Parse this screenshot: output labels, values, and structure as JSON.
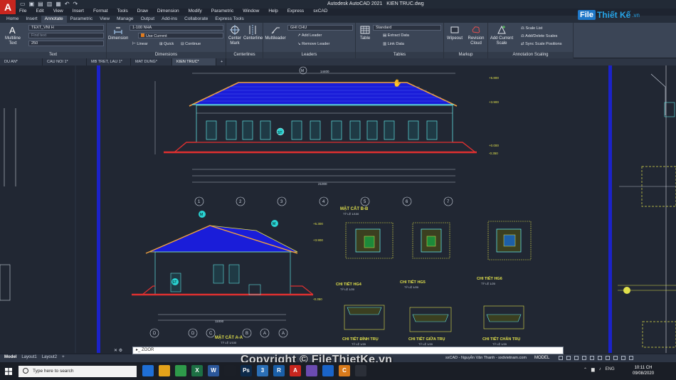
{
  "title": {
    "app": "Autodesk AutoCAD 2021",
    "file": "KIEN TRUC.dwg",
    "logo": "A"
  },
  "menu": [
    "File",
    "Edit",
    "View",
    "Insert",
    "Format",
    "Tools",
    "Draw",
    "Dimension",
    "Modify",
    "Parametric",
    "Window",
    "Help",
    "Express",
    "sxCAD"
  ],
  "ribbon_tabs": [
    "Home",
    "Insert",
    "Annotate",
    "Parametric",
    "View",
    "Manage",
    "Output",
    "Add-ins",
    "Collaborate",
    "Express Tools"
  ],
  "ribbon": {
    "text": {
      "title": "Text",
      "multiline": "Multiline Text",
      "style": "TEXT_VNI H",
      "find_placeholder": "Find text",
      "height": "250"
    },
    "dimensions": {
      "title": "Dimensions",
      "dimension": "Dimension",
      "style": "1-100 NHA",
      "layer": "Use Current",
      "linear": "Linear",
      "quick": "Quick",
      "continue": "Continue"
    },
    "centerlines": {
      "title": "Centerlines",
      "center_mark": "Center Mark",
      "centerline": "Centerline"
    },
    "leaders": {
      "title": "Leaders",
      "multileader": "Multileader",
      "style": "GHI CHU",
      "add": "Add Leader",
      "remove": "Remove Leader"
    },
    "tables": {
      "title": "Tables",
      "table": "Table",
      "style": "Standard",
      "extract": "Extract Data",
      "link": "Link Data"
    },
    "markup": {
      "title": "Markup",
      "wipeout": "Wipeout",
      "revision": "Revision Cloud"
    },
    "scaling": {
      "title": "Annotation Scaling",
      "add_current": "Add Current Scale",
      "scale_list": "Scale List",
      "add_delete": "Add/Delete Scales",
      "sync": "Sync Scale Positions"
    }
  },
  "doc_tabs": [
    "DU AN*",
    "CAU NOI 1*",
    "MB TRET, LAU 1*",
    "MAT DUNG*",
    "KIEN TRUC*"
  ],
  "drawing": {
    "top_dim": "14400",
    "elev_levels": [
      "+5.800",
      "+5.300",
      "+3.900",
      "+0.000",
      "-0.150",
      "-0.350"
    ],
    "sec_bb_title": "MẶT CẮT B-B",
    "sec_bb_scale": "TỶ LỆ 1/100",
    "sec_aa_title": "MẶT CẮT A-A",
    "sec_aa_scale": "TỶ LỆ 1/100",
    "details": [
      {
        "title": "CHI TIẾT HG4",
        "scale": "TỶ LỆ 1/20"
      },
      {
        "title": "CHI TIẾT HG5",
        "scale": "TỶ LỆ 1/20"
      },
      {
        "title": "CHI TIẾT HG6",
        "scale": "TỶ LỆ 1/20"
      },
      {
        "title": "CHI TIẾT ĐỈNH TRỤ",
        "scale": "TỶ LỆ 1/20"
      },
      {
        "title": "CHI TIẾT GIỮA TRỤ",
        "scale": "TỶ LỆ 1/20"
      },
      {
        "title": "CHI TIẾT CHÂN TRỤ",
        "scale": "TỶ LỆ 1/20"
      }
    ],
    "axis_labels": [
      "1",
      "2",
      "3",
      "4",
      "5",
      "6",
      "7"
    ],
    "axis_labels_aa": [
      "D",
      "C",
      "B",
      "A"
    ],
    "grid_marks": [
      "M",
      "ST"
    ],
    "total_dim": "21000",
    "aa_total_dim": "11000"
  },
  "brand": {
    "box": "File",
    "name": "Thiết Kế",
    "domain": ".vn"
  },
  "command": {
    "prompt": "ZOOR"
  },
  "layout_tabs": [
    "Model",
    "Layout1",
    "Layout2"
  ],
  "status": {
    "info": "sxCAD - Nguyễn Văn Thanh - sxdvietnam.com",
    "model": "MODEL"
  },
  "copyright": "Copyright © FileThietKe.vn",
  "taskbar": {
    "search_placeholder": "Type here to search",
    "apps": [
      {
        "label": "",
        "color": "#1f6fd6",
        "icon": "task-view-icon"
      },
      {
        "label": "",
        "color": "#e3a21a",
        "icon": "file-explorer-icon"
      },
      {
        "label": "",
        "color": "#2e9a4a",
        "icon": "chrome-icon"
      },
      {
        "label": "X",
        "color": "#1d7044",
        "icon": "excel-icon"
      },
      {
        "label": "W",
        "color": "#2b579a",
        "icon": "word-icon"
      },
      {
        "label": "",
        "color": "#1b1f27",
        "icon": "blank-icon"
      },
      {
        "label": "Ps",
        "color": "#0d2a4a",
        "icon": "photoshop-icon"
      },
      {
        "label": "3",
        "color": "#2b6fb6",
        "icon": "3dsmax-icon"
      },
      {
        "label": "R",
        "color": "#1a5fa8",
        "icon": "revit-icon"
      },
      {
        "label": "A",
        "color": "#c8261f",
        "icon": "autocad-icon"
      },
      {
        "label": "",
        "color": "#6b4bb0",
        "icon": "sketch-icon"
      },
      {
        "label": "",
        "color": "#1a64c8",
        "icon": "vpn-icon"
      },
      {
        "label": "C",
        "color": "#d87a1b",
        "icon": "coccoc-icon"
      },
      {
        "label": "",
        "color": "#2b2f38",
        "icon": "misc-icon"
      }
    ],
    "lang": "ENG",
    "time": "10:11 CH",
    "date": "09/08/2020"
  }
}
